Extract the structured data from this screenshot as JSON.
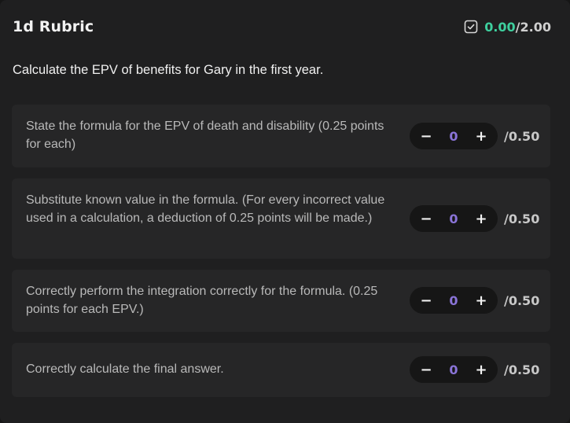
{
  "rubric": {
    "title": "1d Rubric",
    "score_current": "0.00",
    "score_total": "/2.00",
    "question": "Calculate the EPV of benefits for Gary in the first year."
  },
  "criteria": [
    {
      "text": "State the formula for the EPV of death and disability (0.25 points for each)",
      "minus": "−",
      "value": "0",
      "plus": "+",
      "max": "/0.50"
    },
    {
      "text": "Substitute known value in the formula. (For every incorrect value used in a calculation, a deduction of 0.25 points will be made.)",
      "minus": "−",
      "value": "0",
      "plus": "+",
      "max": "/0.50"
    },
    {
      "text": "Correctly perform the integration correctly for the formula. (0.25 points for each EPV.)",
      "minus": "−",
      "value": "0",
      "plus": "+",
      "max": "/0.50"
    },
    {
      "text": "Correctly calculate the final answer.",
      "minus": "−",
      "value": "0",
      "plus": "+",
      "max": "/0.50"
    }
  ],
  "colors": {
    "score_accent": "#3ecf9e",
    "value_accent": "#8a74d8",
    "panel": "#1f1f20",
    "card": "#262627"
  },
  "icons": {
    "score": "checkbox-icon"
  }
}
